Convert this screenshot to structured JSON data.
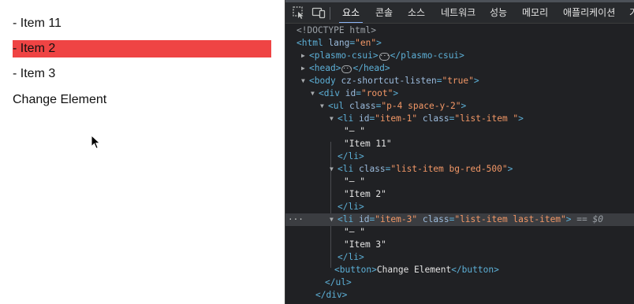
{
  "preview": {
    "items": [
      {
        "text": "- Item 11",
        "highlighted": false
      },
      {
        "text": "- Item 2",
        "highlighted": true
      },
      {
        "text": "- Item 3",
        "highlighted": false
      }
    ],
    "button_label": "Change Element",
    "highlight_color": "#ef4444"
  },
  "devtools": {
    "tool_icons": [
      "inspect-element-icon",
      "device-toolbar-icon"
    ],
    "tabs": [
      {
        "label": "요소",
        "active": true
      },
      {
        "label": "콘솔",
        "active": false
      },
      {
        "label": "소스",
        "active": false
      },
      {
        "label": "네트워크",
        "active": false
      },
      {
        "label": "성능",
        "active": false
      },
      {
        "label": "메모리",
        "active": false
      },
      {
        "label": "애플리케이션",
        "active": false
      },
      {
        "label": "기",
        "active": false
      }
    ],
    "dom": {
      "doctype": "<!DOCTYPE html>",
      "html_lang": "en",
      "head_tag": "head",
      "plasmo_tag": "plasmo-csui",
      "body_attr_name": "cz-shortcut-listen",
      "body_attr_value": "true",
      "root_id": "root",
      "ul_class": "p-4 space-y-2",
      "li1_id": "item-1",
      "li1_class": "list-item ",
      "li1_text_a": "\"– \"",
      "li1_text_b": "\"Item 11\"",
      "li2_class": "list-item bg-red-500",
      "li2_text_a": "\"– \"",
      "li2_text_b": "\"Item 2\"",
      "li3_id": "item-3",
      "li3_class": "list-item last-item",
      "li3_text_a": "\"– \"",
      "li3_text_b": "\"Item 3\"",
      "selected_marker": "== $0",
      "button_text": "Change Element"
    }
  },
  "colors": {
    "devtools_bg": "#202124",
    "tag": "#5db0d7",
    "attr_name": "#9bbbdc",
    "attr_value": "#f29766",
    "tab_underline": "#8ab4f8"
  }
}
